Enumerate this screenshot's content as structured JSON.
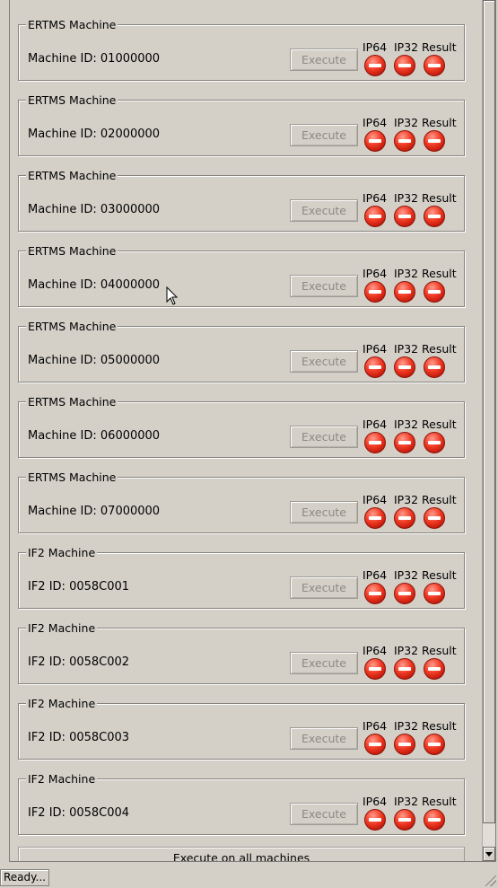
{
  "machines": [
    {
      "group": "ERTMS Machine",
      "id_text": "Machine ID: 01000000",
      "execute": "Execute",
      "ip64": "IP64",
      "ip32": "IP32",
      "result": "Result"
    },
    {
      "group": "ERTMS Machine",
      "id_text": "Machine ID: 02000000",
      "execute": "Execute",
      "ip64": "IP64",
      "ip32": "IP32",
      "result": "Result"
    },
    {
      "group": "ERTMS Machine",
      "id_text": "Machine ID: 03000000",
      "execute": "Execute",
      "ip64": "IP64",
      "ip32": "IP32",
      "result": "Result"
    },
    {
      "group": "ERTMS Machine",
      "id_text": "Machine ID: 04000000",
      "execute": "Execute",
      "ip64": "IP64",
      "ip32": "IP32",
      "result": "Result"
    },
    {
      "group": "ERTMS Machine",
      "id_text": "Machine ID: 05000000",
      "execute": "Execute",
      "ip64": "IP64",
      "ip32": "IP32",
      "result": "Result"
    },
    {
      "group": "ERTMS Machine",
      "id_text": "Machine ID: 06000000",
      "execute": "Execute",
      "ip64": "IP64",
      "ip32": "IP32",
      "result": "Result"
    },
    {
      "group": "ERTMS Machine",
      "id_text": "Machine ID: 07000000",
      "execute": "Execute",
      "ip64": "IP64",
      "ip32": "IP32",
      "result": "Result"
    },
    {
      "group": "IF2 Machine",
      "id_text": "IF2 ID: 0058C001",
      "execute": "Execute",
      "ip64": "IP64",
      "ip32": "IP32",
      "result": "Result"
    },
    {
      "group": "IF2 Machine",
      "id_text": "IF2 ID: 0058C002",
      "execute": "Execute",
      "ip64": "IP64",
      "ip32": "IP32",
      "result": "Result"
    },
    {
      "group": "IF2 Machine",
      "id_text": "IF2 ID: 0058C003",
      "execute": "Execute",
      "ip64": "IP64",
      "ip32": "IP32",
      "result": "Result"
    },
    {
      "group": "IF2 Machine",
      "id_text": "IF2 ID: 0058C004",
      "execute": "Execute",
      "ip64": "IP64",
      "ip32": "IP32",
      "result": "Result"
    }
  ],
  "status_icon": "no-entry-icon",
  "execute_all": "Execute on all machines",
  "status_bar": "Ready...",
  "colors": {
    "window_bg": "#d4d0c8",
    "status_red": "#e8311c",
    "disabled_text": "#8c8a86"
  }
}
